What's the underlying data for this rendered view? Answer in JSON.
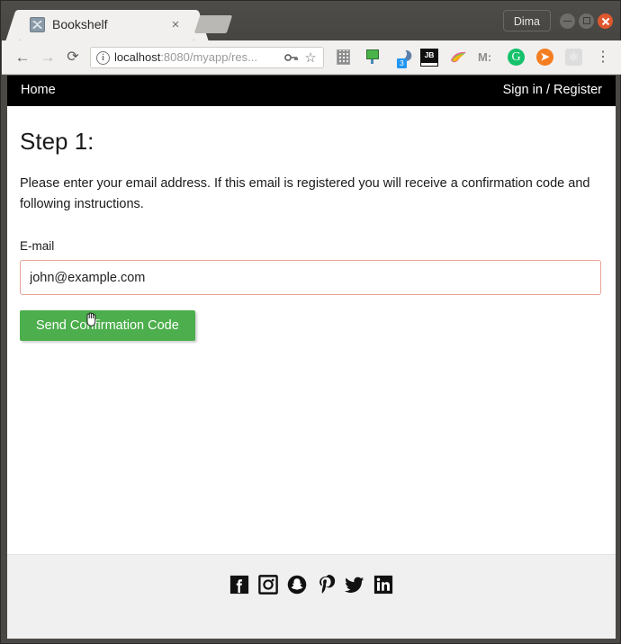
{
  "window": {
    "profile_label": "Dima",
    "minimize_icon": "minimize-icon",
    "maximize_icon": "maximize-icon",
    "close_icon": "close-icon"
  },
  "browser": {
    "tab": {
      "title": "Bookshelf",
      "favicon": "bookshelf-favicon",
      "close_glyph": "×"
    },
    "new_tab_label": "new-tab",
    "nav": {
      "back_glyph": "←",
      "forward_glyph": "→",
      "reload_glyph": "⟳"
    },
    "omnibox": {
      "info_glyph": "i",
      "url_host": "localhost",
      "url_rest": ":8080/myapp/res...",
      "full_value": "localhost:8080/myapp/res...",
      "key_glyph": "⚷",
      "star_glyph": "☆"
    },
    "extensions": [
      {
        "name": "qr-code-extension-icon",
        "label": ""
      },
      {
        "name": "screen-share-extension-icon",
        "label": ""
      },
      {
        "name": "night-mode-extension-icon",
        "label": "",
        "badge": "3"
      },
      {
        "name": "jetbrains-extension-icon",
        "label": "JB"
      },
      {
        "name": "bird-extension-icon",
        "label": ""
      },
      {
        "name": "momentum-extension-icon",
        "label": "M:"
      },
      {
        "name": "grammarly-extension-icon",
        "label": "G"
      },
      {
        "name": "arrow-extension-icon",
        "label": "➤"
      },
      {
        "name": "react-devtools-extension-icon",
        "label": "⚛"
      }
    ],
    "menu_glyph": "⋮"
  },
  "site": {
    "navbar": {
      "home_label": "Home",
      "signin_label": "Sign in / Register"
    },
    "main": {
      "heading": "Step 1:",
      "description": "Please enter your email address. If this email is registered you will receive a confirmation code and following instructions.",
      "email_label": "E-mail",
      "email_value": "john@example.com",
      "email_placeholder": "",
      "submit_label": "Send Confirmation Code"
    },
    "footer": {
      "social": [
        {
          "name": "facebook-icon"
        },
        {
          "name": "instagram-icon"
        },
        {
          "name": "snapchat-icon"
        },
        {
          "name": "pinterest-icon"
        },
        {
          "name": "twitter-icon"
        },
        {
          "name": "linkedin-icon"
        }
      ]
    }
  },
  "colors": {
    "navbar_bg": "#000000",
    "button_green": "#4cae4c",
    "input_border": "#e8a396",
    "footer_bg": "#f0f0f0",
    "chrome_bg": "#f1f0ee",
    "titlebar_bg": "#4a4845"
  }
}
